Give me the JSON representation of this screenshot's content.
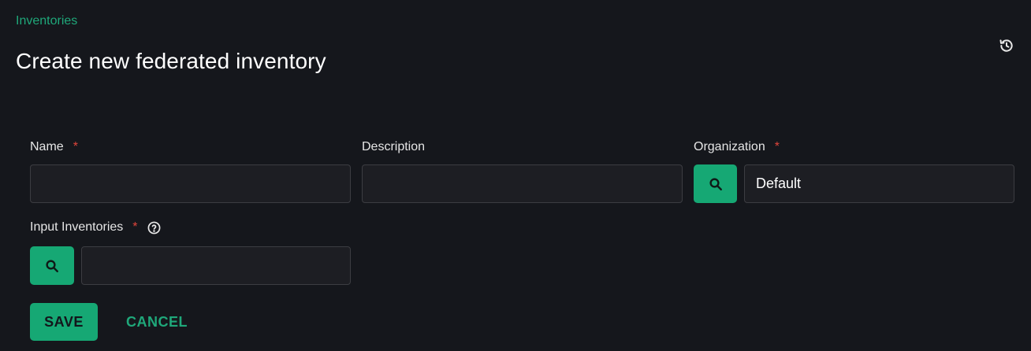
{
  "breadcrumb": {
    "label": "Inventories"
  },
  "header": {
    "title": "Create new federated inventory",
    "history_icon": "history-icon"
  },
  "form": {
    "name": {
      "label": "Name",
      "required_mark": "*",
      "value": ""
    },
    "description": {
      "label": "Description",
      "value": ""
    },
    "organization": {
      "label": "Organization",
      "required_mark": "*",
      "value": "Default",
      "search_icon": "search-icon"
    },
    "input_inventories": {
      "label": "Input Inventories",
      "required_mark": "*",
      "help_icon": "question-circle-icon",
      "value": "",
      "search_icon": "search-icon"
    }
  },
  "actions": {
    "save_label": "SAVE",
    "cancel_label": "CANCEL"
  },
  "colors": {
    "background": "#15171c",
    "accent": "#16a874",
    "link": "#1fa87a",
    "required": "#e0453b",
    "input_bg": "#1d1e23",
    "input_border": "#3c3d42"
  }
}
